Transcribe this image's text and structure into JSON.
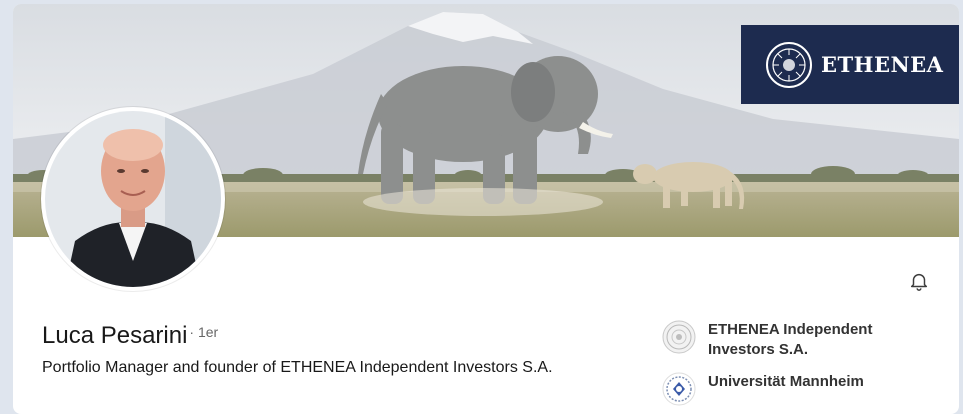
{
  "profile": {
    "name": "Luca Pesarini",
    "connection_degree": "· 1er",
    "headline": "Portfolio Manager and founder of ETHENEA Independent Investors S.A."
  },
  "banner": {
    "brand_name": "ETHENEA",
    "brand_color": "#1d2b4f"
  },
  "companies": [
    {
      "label": "ETHENEA Independent Investors S.A.",
      "icon": "ethenea-logo"
    },
    {
      "label": "Universität Mannheim",
      "icon": "university-seal"
    }
  ],
  "actions": {
    "notify_icon": "bell-icon"
  }
}
